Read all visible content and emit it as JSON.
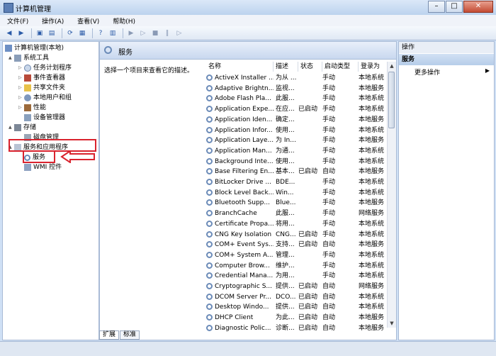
{
  "window": {
    "title": "计算机管理"
  },
  "menu": [
    "文件(F)",
    "操作(A)",
    "查看(V)",
    "帮助(H)"
  ],
  "tree": {
    "items": [
      {
        "label": "计算机管理(本地)",
        "indent": 0,
        "expander": ""
      },
      {
        "label": "系统工具",
        "indent": 1,
        "expander": "▲"
      },
      {
        "label": "任务计划程序",
        "indent": 2,
        "expander": "▷"
      },
      {
        "label": "事件查看器",
        "indent": 2,
        "expander": "▷"
      },
      {
        "label": "共享文件夹",
        "indent": 2,
        "expander": "▷"
      },
      {
        "label": "本地用户和组",
        "indent": 2,
        "expander": "▷"
      },
      {
        "label": "性能",
        "indent": 2,
        "expander": "▷"
      },
      {
        "label": "设备管理器",
        "indent": 2,
        "expander": ""
      },
      {
        "label": "存储",
        "indent": 1,
        "expander": "▲"
      },
      {
        "label": "磁盘管理",
        "indent": 2,
        "expander": ""
      },
      {
        "label": "服务和应用程序",
        "indent": 1,
        "expander": "▲"
      },
      {
        "label": "服务",
        "indent": 2,
        "expander": ""
      },
      {
        "label": "WMI 控件",
        "indent": 2,
        "expander": ""
      }
    ]
  },
  "center": {
    "title": "服务",
    "description_hint": "选择一个项目来查看它的描述。",
    "columns": [
      "名称",
      "描述",
      "状态",
      "启动类型",
      "登录为"
    ],
    "rows": [
      [
        "ActiveX Installer ...",
        "为从 ...",
        "",
        "手动",
        "本地系统"
      ],
      [
        "Adaptive Brightn...",
        "监视...",
        "",
        "手动",
        "本地服务"
      ],
      [
        "Adobe Flash Pla...",
        "此服...",
        "",
        "手动",
        "本地系统"
      ],
      [
        "Application Expe...",
        "在应...",
        "已启动",
        "手动",
        "本地系统"
      ],
      [
        "Application Iden...",
        "确定...",
        "",
        "手动",
        "本地服务"
      ],
      [
        "Application Infor...",
        "使用...",
        "",
        "手动",
        "本地系统"
      ],
      [
        "Application Laye...",
        "为 In...",
        "",
        "手动",
        "本地服务"
      ],
      [
        "Application Man...",
        "为通...",
        "",
        "手动",
        "本地系统"
      ],
      [
        "Background Inte...",
        "使用...",
        "",
        "手动",
        "本地系统"
      ],
      [
        "Base Filtering En...",
        "基本...",
        "已启动",
        "自动",
        "本地服务"
      ],
      [
        "BitLocker Drive ...",
        "BDE...",
        "",
        "手动",
        "本地系统"
      ],
      [
        "Block Level Back...",
        "Win...",
        "",
        "手动",
        "本地系统"
      ],
      [
        "Bluetooth Supp...",
        "Blue...",
        "",
        "手动",
        "本地服务"
      ],
      [
        "BranchCache",
        "此服...",
        "",
        "手动",
        "网络服务"
      ],
      [
        "Certificate Propa...",
        "将用...",
        "",
        "手动",
        "本地系统"
      ],
      [
        "CNG Key Isolation",
        "CNG...",
        "已启动",
        "手动",
        "本地系统"
      ],
      [
        "COM+ Event Sys...",
        "支持...",
        "已启动",
        "自动",
        "本地服务"
      ],
      [
        "COM+ System A...",
        "管理...",
        "",
        "手动",
        "本地系统"
      ],
      [
        "Computer Brow...",
        "维护...",
        "",
        "手动",
        "本地系统"
      ],
      [
        "Credential Mana...",
        "为用...",
        "",
        "手动",
        "本地系统"
      ],
      [
        "Cryptographic S...",
        "提供...",
        "已启动",
        "自动",
        "网络服务"
      ],
      [
        "DCOM Server Pr...",
        "DCO...",
        "已启动",
        "自动",
        "本地系统"
      ],
      [
        "Desktop Windo...",
        "提供...",
        "已启动",
        "自动",
        "本地系统"
      ],
      [
        "DHCP Client",
        "为此...",
        "已启动",
        "自动",
        "本地服务"
      ],
      [
        "Diagnostic Polic...",
        "诊断...",
        "已启动",
        "自动",
        "本地服务"
      ]
    ]
  },
  "tabs": [
    "扩展",
    "标准"
  ],
  "actions": {
    "header": "操作",
    "section": "服务",
    "more": "更多操作"
  },
  "colors": {
    "highlight": "#d9232e",
    "accent": "#2c5ca8"
  }
}
